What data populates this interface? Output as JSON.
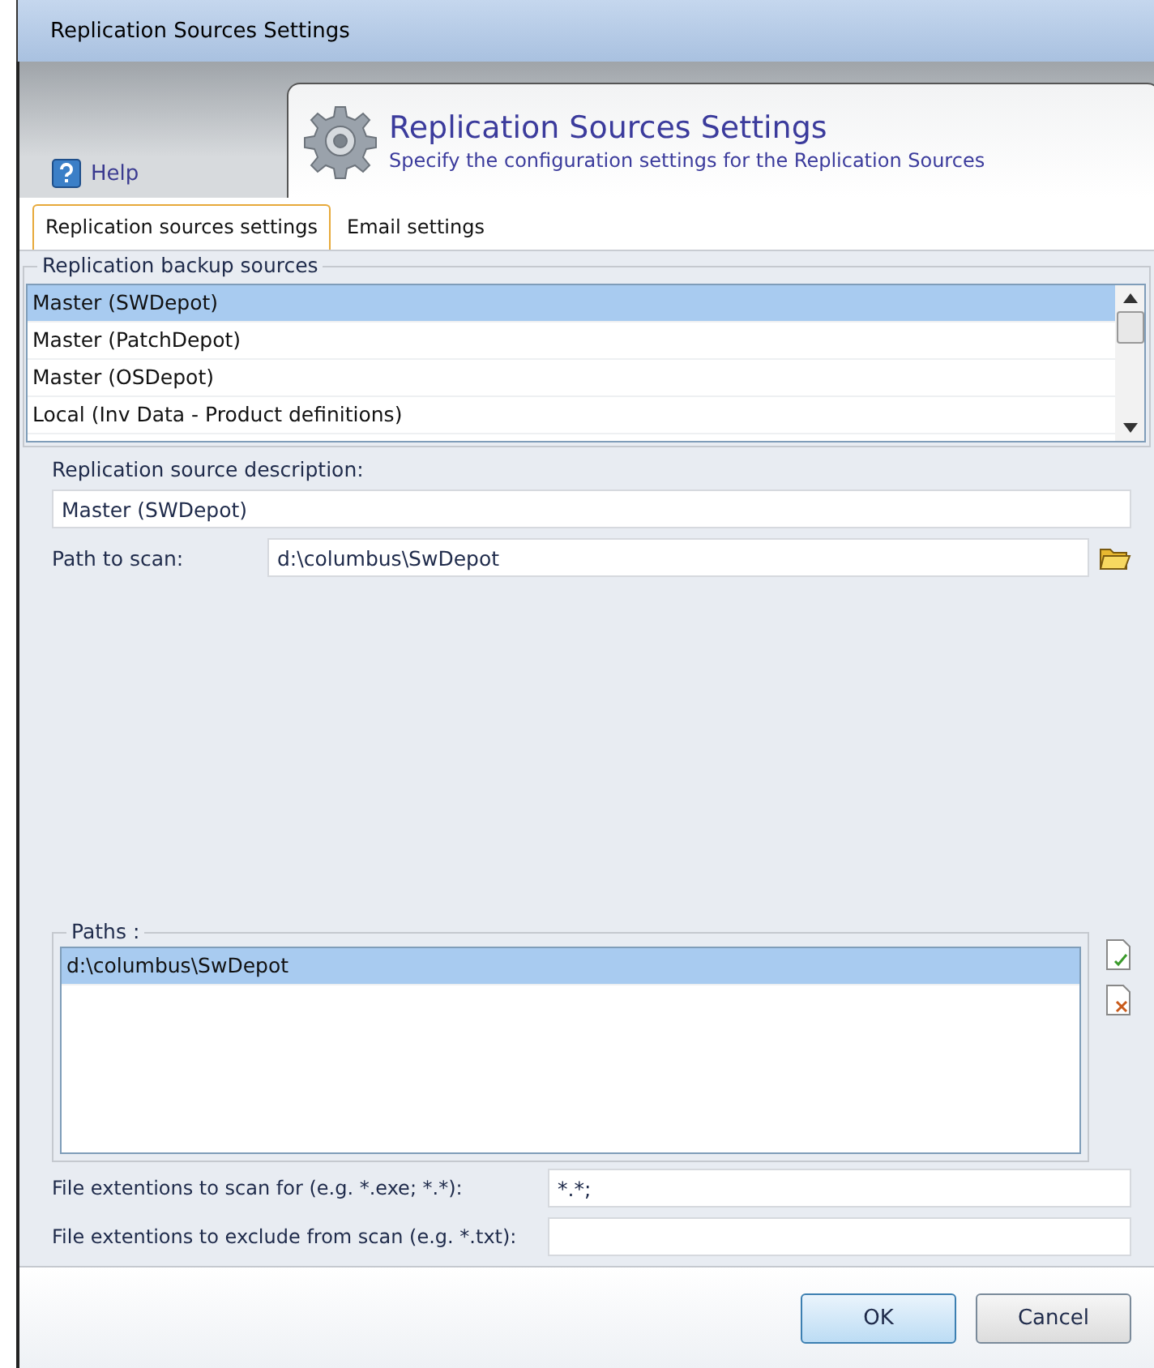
{
  "window": {
    "title": "Replication Sources Settings"
  },
  "help": {
    "label": "Help"
  },
  "header": {
    "title": "Replication Sources Settings",
    "subtitle": "Specify the configuration settings for the Replication Sources"
  },
  "tabs": [
    {
      "label": "Replication sources settings",
      "selected": true
    },
    {
      "label": "Email settings",
      "selected": false
    }
  ],
  "sources": {
    "legend": "Replication backup sources",
    "items": [
      {
        "label": "Master (SWDepot)",
        "selected": true
      },
      {
        "label": "Master (PatchDepot)",
        "selected": false
      },
      {
        "label": "Master (OSDepot)",
        "selected": false
      },
      {
        "label": "Local (Inv Data - Product definitions)",
        "selected": false
      }
    ]
  },
  "description": {
    "label": "Replication source description:",
    "value": "Master (SWDepot)"
  },
  "path": {
    "label": "Path to scan:",
    "value": "d:\\columbus\\SwDepot"
  },
  "paths": {
    "legend": "Paths :",
    "items": [
      {
        "label": "d:\\columbus\\SwDepot",
        "selected": true
      }
    ]
  },
  "extensions": [
    {
      "label": "File extentions to scan for (e.g. *.exe; *.*):",
      "value": "*.*;"
    },
    {
      "label": "File extentions to exclude from scan (e.g. *.txt):"
    }
  ],
  "buttons": [
    "OK",
    "Cancel"
  ]
}
